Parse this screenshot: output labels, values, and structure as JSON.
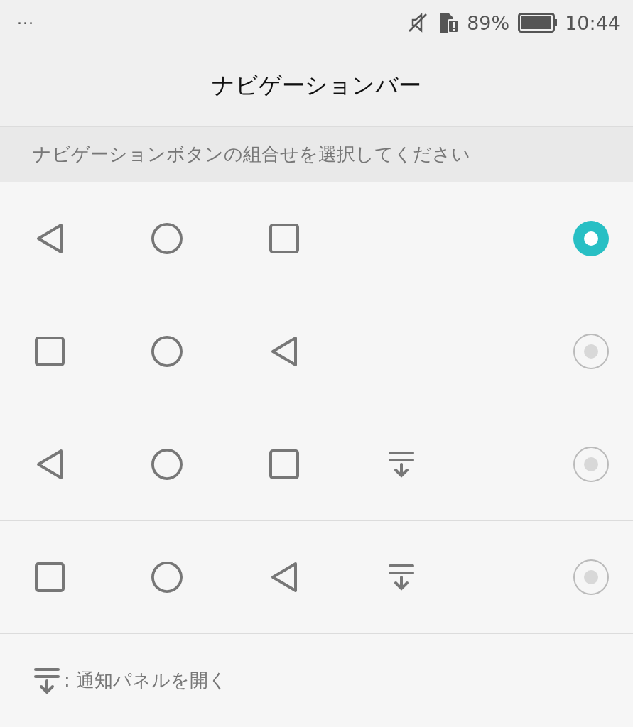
{
  "status_bar": {
    "overflow": "···",
    "battery_percent": "89%",
    "time": "10:44"
  },
  "title": "ナビゲーションバー",
  "section_header": "ナビゲーションボタンの組合せを選択してください",
  "options": [
    {
      "buttons": [
        {
          "kind": "back"
        },
        {
          "kind": "home"
        },
        {
          "kind": "recent"
        }
      ],
      "selected": true
    },
    {
      "buttons": [
        {
          "kind": "recent"
        },
        {
          "kind": "home"
        },
        {
          "kind": "back"
        }
      ],
      "selected": false
    },
    {
      "buttons": [
        {
          "kind": "back"
        },
        {
          "kind": "home"
        },
        {
          "kind": "recent"
        },
        {
          "kind": "notification"
        }
      ],
      "selected": false
    },
    {
      "buttons": [
        {
          "kind": "recent"
        },
        {
          "kind": "home"
        },
        {
          "kind": "back"
        },
        {
          "kind": "notification"
        }
      ],
      "selected": false
    }
  ],
  "legend": {
    "text": ": 通知パネルを開く"
  }
}
